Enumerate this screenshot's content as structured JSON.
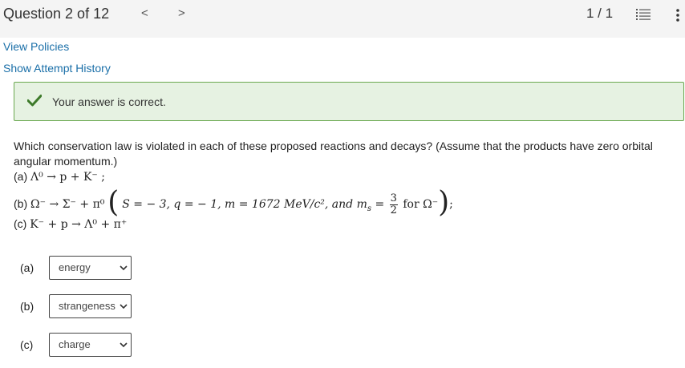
{
  "header": {
    "question_label": "Question 2 of 12",
    "prev_glyph": "<",
    "next_glyph": ">",
    "page_count": "1 / 1",
    "list_icon": "list-icon",
    "more_icon": "more-vertical-icon"
  },
  "links": {
    "view_policies": "View Policies",
    "attempt_history": "Show Attempt History"
  },
  "feedback": {
    "icon": "checkmark-icon",
    "text": "Your answer is correct.",
    "accent_color": "#6aa84f",
    "background_color": "#e6f2e2"
  },
  "question": {
    "prompt": "Which conservation law is violated in each of these proposed reactions and decays? (Assume that the products have zero orbital angular momentum.)",
    "a_label": "(a)",
    "a_expr": "Λ⁰ → p + K⁻ ;",
    "b_label": "(b)",
    "b_expr": "Ω⁻ → Σ⁻ + π⁰",
    "b_cond": "S = − 3,  q = − 1,  m = 1672 MeV/c²,  and m",
    "b_sub": "s",
    "b_eq": " = ",
    "b_frac_num": "3",
    "b_frac_den": "2",
    "b_tail": " for Ω⁻",
    "b_end": ";",
    "c_label": "(c)",
    "c_expr": "K⁻  + p  → Λ⁰ + π⁺"
  },
  "answers": [
    {
      "label": "(a)",
      "selected": "energy"
    },
    {
      "label": "(b)",
      "selected": "strangeness"
    },
    {
      "label": "(c)",
      "selected": "charge"
    }
  ]
}
